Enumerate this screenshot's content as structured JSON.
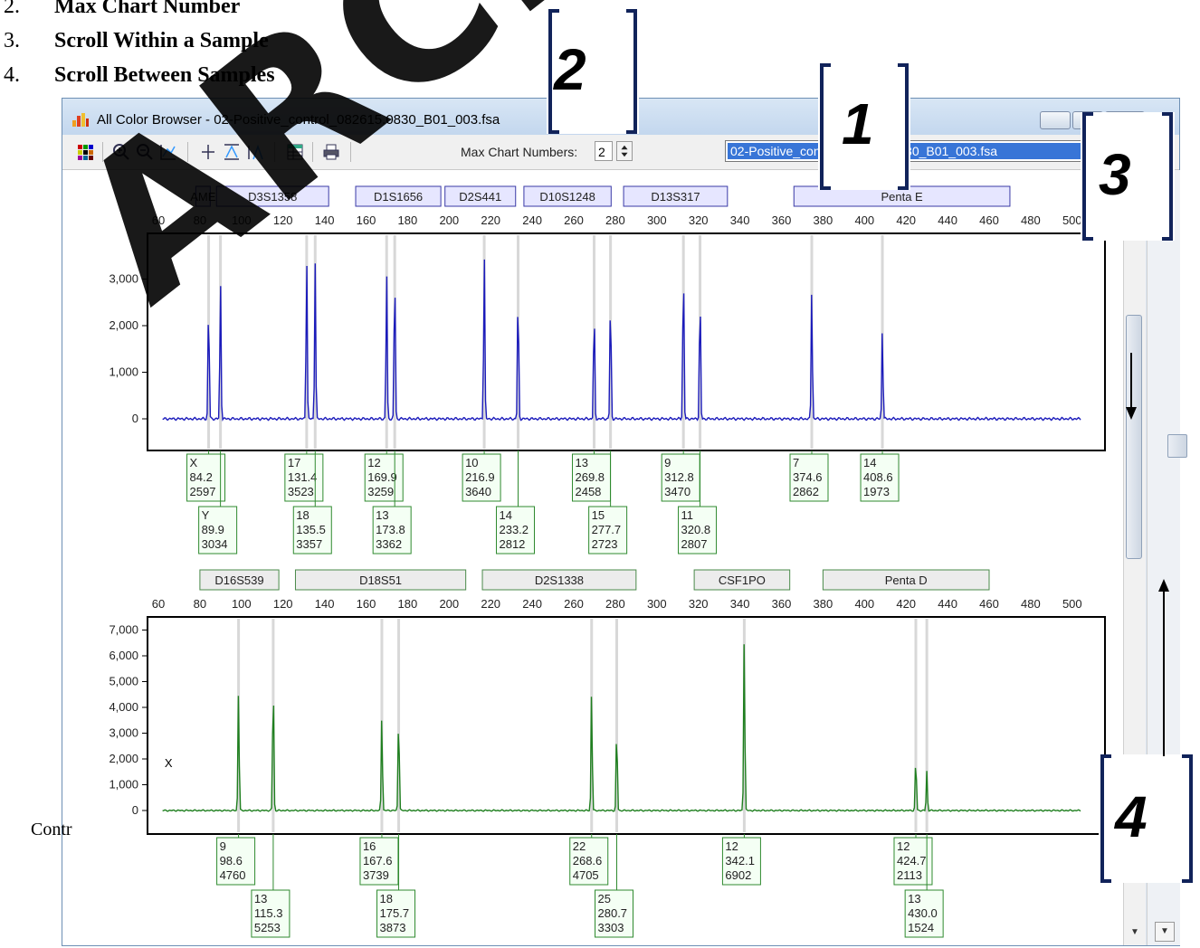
{
  "document": {
    "list": [
      {
        "num": "2.",
        "text": "Max Chart Number"
      },
      {
        "num": "3.",
        "text": "Scroll Within a Sample"
      },
      {
        "num": "4.",
        "text": "Scroll Between Samples"
      }
    ],
    "footer_fragment": "Contr",
    "watermark": "ARCHI"
  },
  "window": {
    "title": "All Color Browser - 02-Positive_control_082615.0830_B01_003.fsa",
    "toolbar": {
      "max_chart_label": "Max Chart Numbers:",
      "max_chart_value": "2",
      "sample_selected": "02-Positive_control_082615.0830_B01_003.fsa"
    }
  },
  "callouts": [
    "1",
    "2",
    "3",
    "4"
  ],
  "colors": {
    "blue_trace": "#1b1bbb",
    "green_trace": "#1f7f1f",
    "callout": "#11235a"
  },
  "charts": {
    "size_axis_ticks": [
      "60",
      "80",
      "100",
      "120",
      "140",
      "160",
      "180",
      "200",
      "220",
      "240",
      "260",
      "280",
      "300",
      "320",
      "340",
      "360",
      "380",
      "400",
      "420",
      "440",
      "460",
      "480",
      "500"
    ],
    "blue": {
      "loci": [
        "AME",
        "D3S1358",
        "D1S1656",
        "D2S441",
        "D10S1248",
        "D13S317",
        "Penta E"
      ],
      "y_ticks": [
        "3,000",
        "2,000",
        "1,000",
        "0"
      ],
      "peaks": [
        {
          "allele": "X",
          "size": "84.2",
          "height": "2597"
        },
        {
          "allele": "Y",
          "size": "89.9",
          "height": "3034"
        },
        {
          "allele": "17",
          "size": "131.4",
          "height": "3523"
        },
        {
          "allele": "18",
          "size": "135.5",
          "height": "3357"
        },
        {
          "allele": "12",
          "size": "169.9",
          "height": "3259"
        },
        {
          "allele": "13",
          "size": "173.8",
          "height": "3362"
        },
        {
          "allele": "10",
          "size": "216.9",
          "height": "3640"
        },
        {
          "allele": "14",
          "size": "233.2",
          "height": "2812"
        },
        {
          "allele": "13",
          "size": "269.8",
          "height": "2458"
        },
        {
          "allele": "15",
          "size": "277.7",
          "height": "2723"
        },
        {
          "allele": "9",
          "size": "312.8",
          "height": "3470"
        },
        {
          "allele": "11",
          "size": "320.8",
          "height": "2807"
        },
        {
          "allele": "7",
          "size": "374.6",
          "height": "2862"
        },
        {
          "allele": "14",
          "size": "408.6",
          "height": "1973"
        }
      ]
    },
    "green": {
      "loci": [
        "D16S539",
        "D18S51",
        "D2S1338",
        "CSF1PO",
        "Penta D"
      ],
      "y_ticks": [
        "7,000",
        "6,000",
        "5,000",
        "4,000",
        "3,000",
        "2,000",
        "1,000",
        "0"
      ],
      "marker_label": "X",
      "peaks": [
        {
          "allele": "9",
          "size": "98.6",
          "height": "4760"
        },
        {
          "allele": "13",
          "size": "115.3",
          "height": "5253"
        },
        {
          "allele": "16",
          "size": "167.6",
          "height": "3739"
        },
        {
          "allele": "18",
          "size": "175.7",
          "height": "3873"
        },
        {
          "allele": "22",
          "size": "268.6",
          "height": "4705"
        },
        {
          "allele": "25",
          "size": "280.7",
          "height": "3303"
        },
        {
          "allele": "12",
          "size": "342.1",
          "height": "6902"
        },
        {
          "allele": "12",
          "size": "424.7",
          "height": "2113"
        },
        {
          "allele": "13",
          "size": "430.0",
          "height": "1524"
        }
      ]
    }
  }
}
